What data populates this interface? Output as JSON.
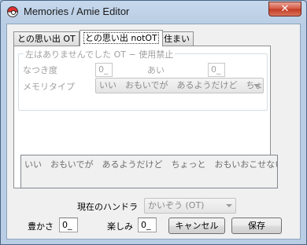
{
  "window": {
    "title": "Memories / Amie Editor",
    "close_glyph": "✕"
  },
  "tabs": [
    {
      "label": "との思い出 OT"
    },
    {
      "label": "との思い出 notOT"
    },
    {
      "label": "住まい"
    }
  ],
  "panel": {
    "group_legend": "左はありませんでした OT − 使用禁止",
    "friendship_label": "なつき度",
    "friendship_value": "0_",
    "affection_label": "あい",
    "affection_value": "0_",
    "memory_type_label": "メモリタイプ",
    "memory_type_value": "いい　おもいでが　あるようだけど　ちょっと　おもい"
  },
  "memory_text": "いい　おもいでが　あるようだけど　ちょっと　おもいおこせないみたい……",
  "handler": {
    "label": "現在のハンドラ",
    "value": "かいぞう (OT)"
  },
  "fullness": {
    "label": "豊かさ",
    "value": "0_"
  },
  "enjoyment": {
    "label": "楽しみ",
    "value": "0_"
  },
  "buttons": {
    "cancel": "キャンセル",
    "save": "保存"
  }
}
